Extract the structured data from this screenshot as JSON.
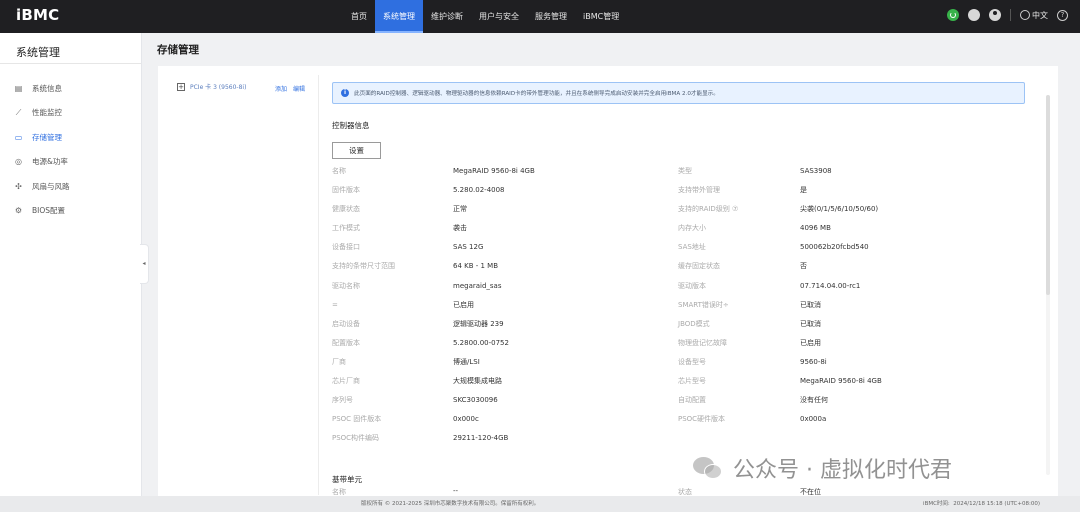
{
  "app": {
    "logo": "iBMC"
  },
  "topnav": {
    "items": [
      {
        "label": "首页"
      },
      {
        "label": "系统管理",
        "active": true
      },
      {
        "label": "维护诊断"
      },
      {
        "label": "用户与安全"
      },
      {
        "label": "服务管理"
      },
      {
        "label": "iBMC管理"
      }
    ],
    "language": "中文"
  },
  "sidebar": {
    "title": "系统管理",
    "items": [
      {
        "label": "系统信息",
        "icon": "system-info-icon"
      },
      {
        "label": "性能监控",
        "icon": "chart-icon"
      },
      {
        "label": "存储管理",
        "icon": "storage-icon",
        "active": true
      },
      {
        "label": "电源&功率",
        "icon": "power-icon"
      },
      {
        "label": "风扇与风路",
        "icon": "fan-icon"
      },
      {
        "label": "BIOS配置",
        "icon": "gear-icon"
      }
    ]
  },
  "page": {
    "title": "存储管理"
  },
  "tree": {
    "node_label": "PCIe 卡 3 (9560-8i)",
    "add_label": "添加",
    "edit_label": "编辑"
  },
  "info_bar": {
    "text": "此页面的RAID控制器、逻辑驱动器、物理驱动器的信息依赖RAID卡的带外管理功能，并且在系统侧导完成启动安装并完全启用iBMA 2.0才能显示。"
  },
  "controller": {
    "section_title": "控制器信息",
    "settings_button": "设置",
    "rows": [
      {
        "l1": "名称",
        "v1": "MegaRAID 9560-8i 4GB",
        "l2": "类型",
        "v2": "SAS3908"
      },
      {
        "l1": "固件版本",
        "v1": "5.280.02-4008",
        "l2": "支持带外管理",
        "v2": "是"
      },
      {
        "l1": "健康状态",
        "v1": "正常",
        "l2": "支持的RAID级别 ⑦",
        "v2": "尖袭(0/1/5/6/10/50/60)"
      },
      {
        "l1": "工作模式",
        "v1": "袭击",
        "l2": "内存大小",
        "v2": "4096 MB"
      },
      {
        "l1": "设备接口",
        "v1": "SAS 12G",
        "l2": "SAS地址",
        "v2": "500062b20fcbd540"
      },
      {
        "l1": "支持的条带尺寸范围",
        "v1": "64 KB - 1 MB",
        "l2": "缓存固定状态",
        "v2": "否"
      },
      {
        "l1": "驱动名称",
        "v1": "megaraid_sas",
        "l2": "驱动版本",
        "v2": "07.714.04.00-rc1"
      },
      {
        "l1": "=",
        "v1": "已启用",
        "l2": "SMART错误时÷",
        "v2": "已取消"
      },
      {
        "l1": "启动设备",
        "v1": "逻辑驱动器 239",
        "l2": "JBOD模式",
        "v2": "已取消"
      },
      {
        "l1": "配置版本",
        "v1": "5.2800.00-0752",
        "l2": "物理盘记忆故障",
        "v2": "已启用"
      },
      {
        "l1": "厂商",
        "v1": "博通/LSI",
        "l2": "设备型号",
        "v2": "9560-8i"
      },
      {
        "l1": "芯片厂商",
        "v1": "大规模集成电路",
        "l2": "芯片型号",
        "v2": "MegaRAID 9560-8i 4GB"
      },
      {
        "l1": "序列号",
        "v1": "SKC3030096",
        "l2": "自动配置",
        "v2": "没有任何"
      },
      {
        "l1": "PSOC 固件版本",
        "v1": "0x000c",
        "l2": "PSOC硬件版本",
        "v2": "0x000a"
      },
      {
        "l1": "PSOC构件编码",
        "v1": "29211-120-4GB",
        "l2": "",
        "v2": ""
      }
    ]
  },
  "baseboard": {
    "section_title": "基带单元",
    "row": {
      "l1": "名称",
      "v1": "--",
      "l2": "状态",
      "v2": "不在位"
    }
  },
  "footer": {
    "copyright": "版权所有 © 2021-2025 深圳市芯聚数字技术有限公司。保留所有权利。",
    "time_label": "iBMC时间:",
    "time_value": "2024/12/18 15:18 (UTC+08:00)"
  },
  "watermark": {
    "text": "公众号 · 虚拟化时代君"
  }
}
